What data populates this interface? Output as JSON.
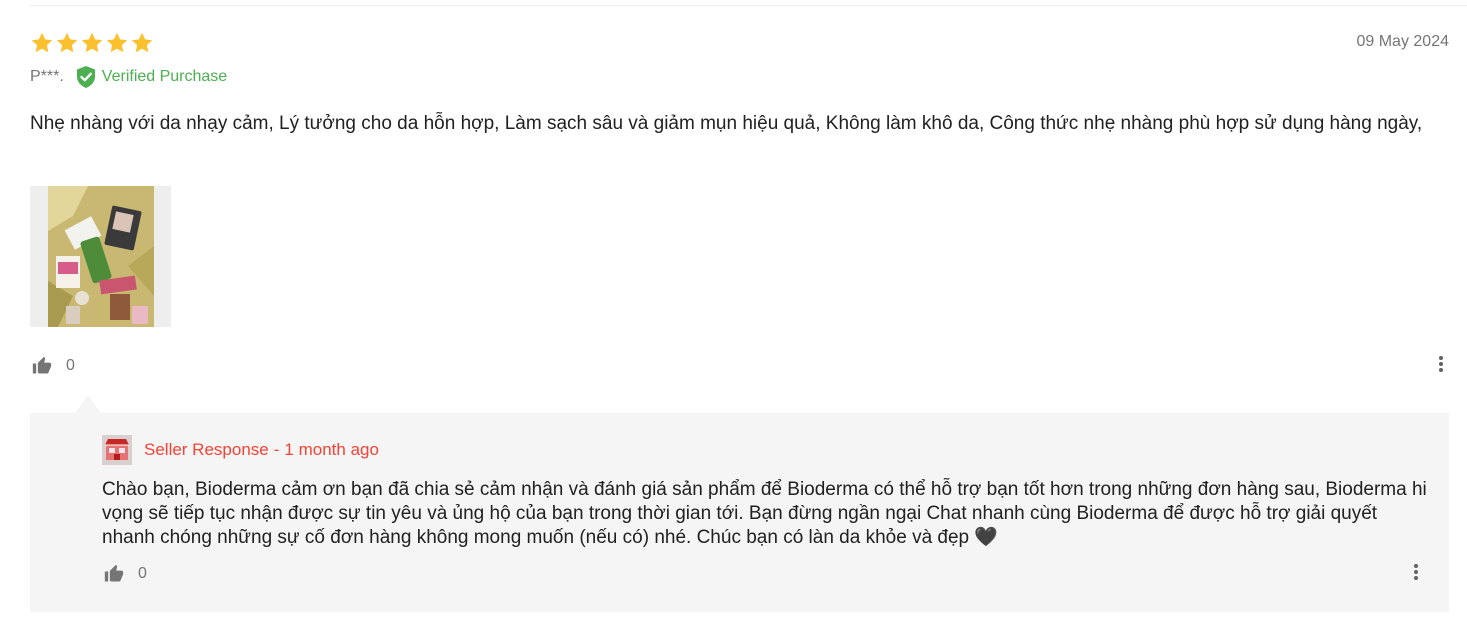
{
  "review": {
    "rating": 5,
    "max_rating": 5,
    "star_color": "#fbc02d",
    "date": "09 May 2024",
    "reviewer_name": "P***.",
    "verified_label": "Verified Purchase",
    "verified_color": "#4caf50",
    "icon_verified": "shield-check-icon",
    "text": "Nhẹ nhàng với da nhạy cảm, Lý tưởng cho da hỗn hợp, Làm sạch sâu và giảm mụn hiệu quả, Không làm khô da, Công thức nhẹ nhàng phù hợp sử dụng hàng ngày,",
    "photo_icon": "product-photo-thumbnail",
    "like_icon": "thumbs-up-icon",
    "like_count": "0",
    "more_icon": "more-vertical-icon"
  },
  "seller_response": {
    "avatar_icon": "store-avatar-icon",
    "label": "Seller Response",
    "separator": "-",
    "time_ago": "1 month ago",
    "accent_color": "#f44336",
    "text": "Chào bạn, Bioderma cảm ơn bạn đã chia sẻ cảm nhận và đánh giá sản phẩm để Bioderma có thể hỗ trợ bạn tốt hơn trong những đơn hàng sau, Bioderma hi vọng sẽ tiếp tục nhận được sự tin yêu và ủng hộ của bạn trong thời gian tới. Bạn đừng ngần ngại Chat nhanh cùng Bioderma để được hỗ trợ giải quyết nhanh chóng những sự cố đơn hàng không mong muốn (nếu có) nhé. Chúc bạn có làn da khỏe và đẹp 🖤",
    "like_icon": "thumbs-up-icon",
    "like_count": "0",
    "more_icon": "more-vertical-icon"
  }
}
